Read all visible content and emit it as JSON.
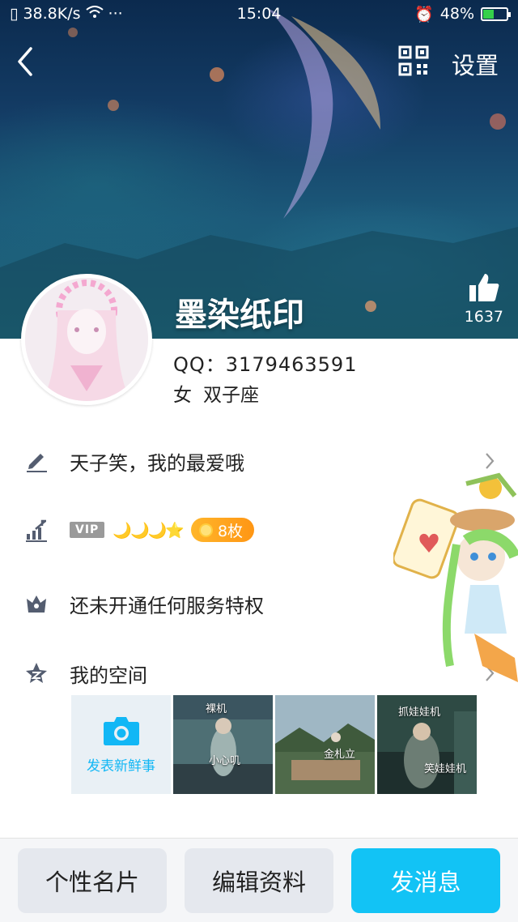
{
  "status_bar": {
    "network_speed": "38.8K/s",
    "more": "···",
    "time": "15:04",
    "battery": "48%"
  },
  "header": {
    "settings_label": "设置",
    "like_count": "1637"
  },
  "profile": {
    "nickname": "墨染纸印",
    "qq": "QQ：3179463591",
    "gender": "女",
    "zodiac": "双子座"
  },
  "rows": {
    "signature": "天子笑，我的最爱哦",
    "vip_label": "VIP",
    "level_icons": "🌙🌙🌙⭐",
    "coins": "8枚",
    "service": "还未开通任何服务特权",
    "qzone": "我的空间"
  },
  "qzone_photos": {
    "post_label": "发表新鲜事",
    "photo1_caption_top": "裸机",
    "photo1_caption_mid": "小心叽",
    "photo2_caption": "金札立",
    "photo3_caption_top": "抓娃娃机",
    "photo3_caption_mid": "笑娃娃机"
  },
  "bottom": {
    "card_button": "个性名片",
    "edit_button": "编辑资料",
    "message_button": "发消息"
  },
  "colors": {
    "accent": "#12c3f5",
    "coin_orange": "#ff9c18",
    "vip_grey": "#9a9a9a"
  }
}
